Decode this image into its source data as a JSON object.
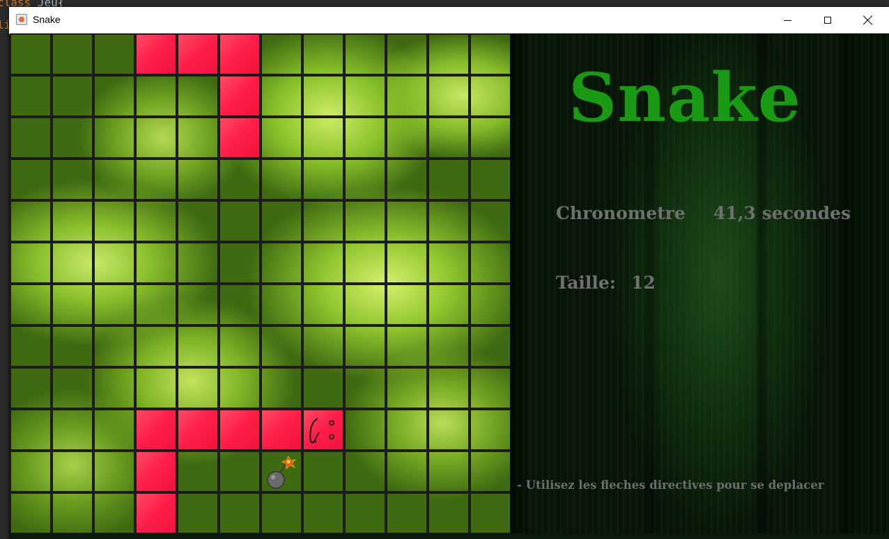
{
  "window": {
    "title": "Snake",
    "buttons": {
      "minimize": "minimize-icon",
      "maximize": "maximize-icon",
      "close": "close-icon"
    }
  },
  "background_code": {
    "line1_keyword": "class",
    "line1_text": "Jeu{",
    "line2_text": "li"
  },
  "panel": {
    "title": "Snake",
    "chrono_label": "Chronometre",
    "chrono_value": "41,3 secondes",
    "taille_label": "Taille:",
    "taille_value": "12",
    "instruction": "- Utilisez les fleches directives pour se deplacer"
  },
  "game": {
    "grid": {
      "columns": 12,
      "rows": 12
    },
    "snake_segments": [
      [
        3,
        0
      ],
      [
        4,
        0
      ],
      [
        5,
        0
      ],
      [
        5,
        1
      ],
      [
        5,
        2
      ],
      [
        3,
        9
      ],
      [
        4,
        9
      ],
      [
        5,
        9
      ],
      [
        6,
        9
      ],
      [
        3,
        10
      ],
      [
        3,
        11
      ]
    ],
    "snake_head": [
      7,
      9
    ],
    "bomb": [
      6,
      10
    ],
    "colors": {
      "snake": "#ff1d4a",
      "grid": "#1c1c1c",
      "title": "#1a9a14",
      "text": "#707070"
    }
  }
}
